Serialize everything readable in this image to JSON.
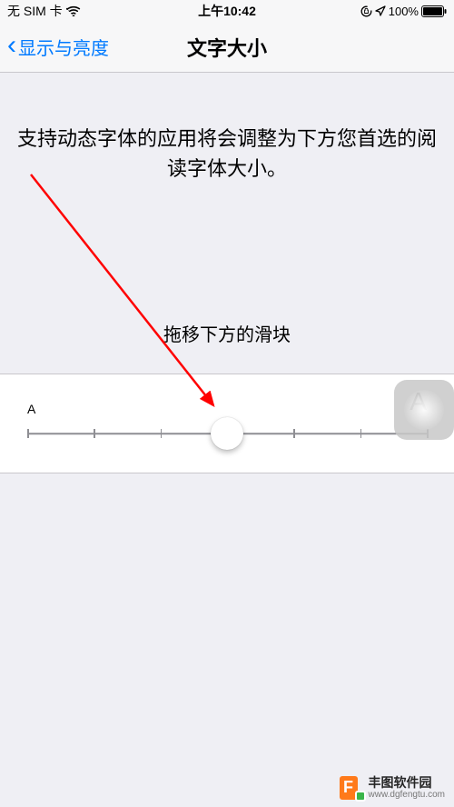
{
  "status": {
    "carrier": "无 SIM 卡",
    "time": "上午10:42",
    "battery": "100%"
  },
  "nav": {
    "back_label": "显示与亮度",
    "title": "文字大小"
  },
  "body": {
    "dynamic_type_message": "支持动态字体的应用将会调整为下方您首选的阅读字体大小。",
    "slider_hint": "拖移下方的滑块",
    "small_a": "A",
    "big_a": "A"
  },
  "slider": {
    "steps": 7,
    "value_index": 3
  },
  "watermark": {
    "logo_letter": "F",
    "title": "丰图软件园",
    "url": "www.dgfengtu.com"
  }
}
